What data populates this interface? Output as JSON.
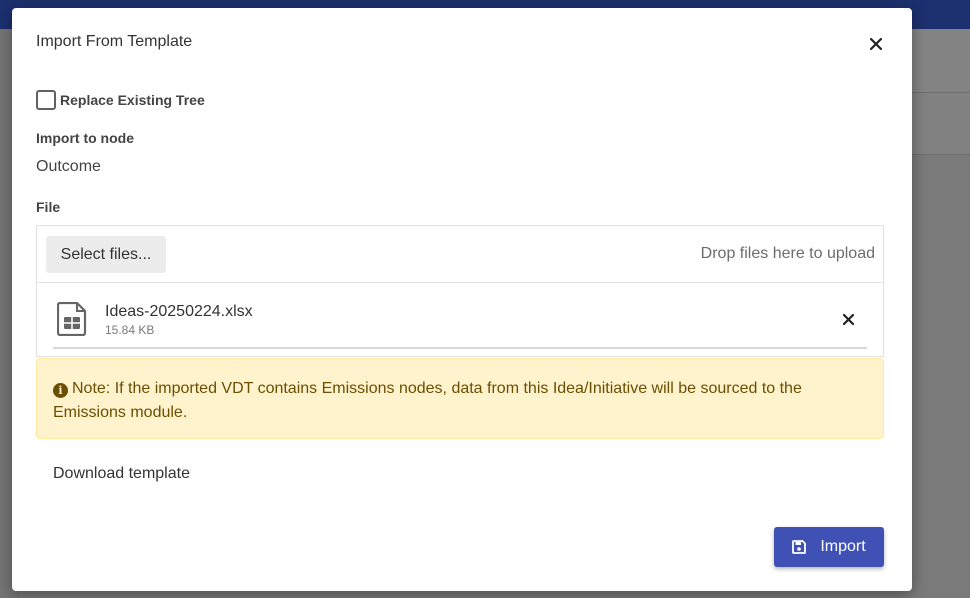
{
  "dialog": {
    "title": "Import From Template",
    "close_icon": "close-icon"
  },
  "replace_tree": {
    "label": "Replace Existing Tree",
    "checked": false
  },
  "import_node": {
    "label": "Import to node",
    "value": "Outcome"
  },
  "file": {
    "label": "File",
    "select_button": "Select files...",
    "drop_hint": "Drop files here to upload",
    "items": [
      {
        "icon": "spreadsheet-file-icon",
        "name": "Ideas-20250224.xlsx",
        "size": "15.84 KB",
        "progress": 0
      }
    ]
  },
  "note": {
    "icon": "info-circle-icon",
    "text": "Note: If the imported VDT contains Emissions nodes, data from this Idea/Initiative will be sourced to the Emissions module.",
    "background": "#fff3cd",
    "color": "#6b4e00"
  },
  "download_template_label": "Download template",
  "import_button": {
    "label": "Import",
    "icon": "save-icon",
    "color": "#3f51b5"
  }
}
